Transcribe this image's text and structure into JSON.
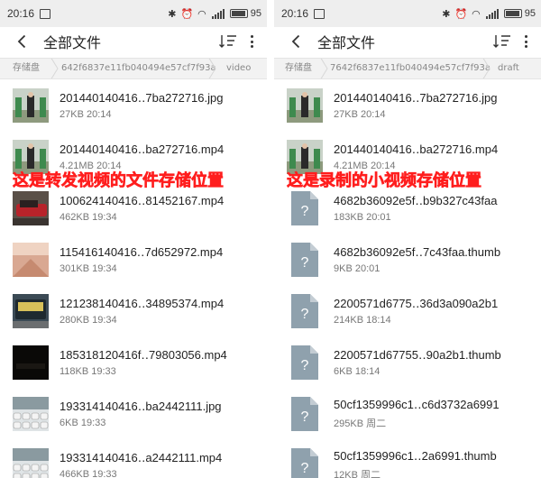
{
  "left": {
    "status": {
      "time": "20:16",
      "battery_pct": "95",
      "battery_level": 0.95
    },
    "toolbar": {
      "title": "全部文件"
    },
    "breadcrumb": {
      "root": "存储盘",
      "middle": "642f6837e11fb040494e57cf7f93a",
      "current": "video"
    },
    "overlay_text": "这是转发视频的文件存储位置",
    "files": [
      {
        "name": "201440140416‥7ba272716.jpg",
        "meta": "27KB  20:14",
        "thumb": "photo-green"
      },
      {
        "name": "201440140416‥ba272716.mp4",
        "meta": "4.21MB  20:14",
        "thumb": "photo-green"
      },
      {
        "name": "100624140416‥81452167.mp4",
        "meta": "462KB  19:34",
        "thumb": "photo-car"
      },
      {
        "name": "115416140416‥7d652972.mp4",
        "meta": "301KB  19:34",
        "thumb": "photo-street"
      },
      {
        "name": "121238140416‥34895374.mp4",
        "meta": "280KB  19:34",
        "thumb": "photo-bus"
      },
      {
        "name": "185318120416f‥79803056.mp4",
        "meta": "118KB  19:33",
        "thumb": "photo-dark"
      },
      {
        "name": "193314140416‥ba2442111.jpg",
        "meta": "6KB  19:33",
        "thumb": "photo-cars"
      },
      {
        "name": "193314140416‥a2442111.mp4",
        "meta": "466KB  19:33",
        "thumb": "photo-cars"
      }
    ]
  },
  "right": {
    "status": {
      "time": "20:16",
      "battery_pct": "95",
      "battery_level": 0.95
    },
    "toolbar": {
      "title": "全部文件"
    },
    "breadcrumb": {
      "root": "存储盘",
      "middle": "7642f6837e11fb040494e57cf7f93a",
      "current": "draft"
    },
    "overlay_text": "这是录制的小视频存储位置",
    "files": [
      {
        "name": "201440140416‥7ba272716.jpg",
        "meta": "27KB  20:14",
        "thumb": "photo-green"
      },
      {
        "name": "201440140416‥ba272716.mp4",
        "meta": "4.21MB  20:14",
        "thumb": "photo-green"
      },
      {
        "name": "4682b36092e5f‥b9b327c43faa",
        "meta": "183KB  20:01",
        "thumb": "unknown"
      },
      {
        "name": "4682b36092e5f‥7c43faa.thumb",
        "meta": "9KB  20:01",
        "thumb": "unknown"
      },
      {
        "name": "2200571d6775‥36d3a090a2b1",
        "meta": "214KB  18:14",
        "thumb": "unknown"
      },
      {
        "name": "2200571d67755‥90a2b1.thumb",
        "meta": "6KB  18:14",
        "thumb": "unknown"
      },
      {
        "name": "50cf1359996c1‥c6d3732a6991",
        "meta": "295KB  周二",
        "thumb": "unknown"
      },
      {
        "name": "50cf1359996c1‥2a6991.thumb",
        "meta": "12KB  周二",
        "thumb": "unknown"
      }
    ]
  },
  "colors": {
    "overlay_text": "#ff1e1e",
    "statusbar_bg": "#eeeeee",
    "breadcrumb_bg": "#f2f2f2",
    "unknown_file_icon": "#8fa1ad"
  }
}
